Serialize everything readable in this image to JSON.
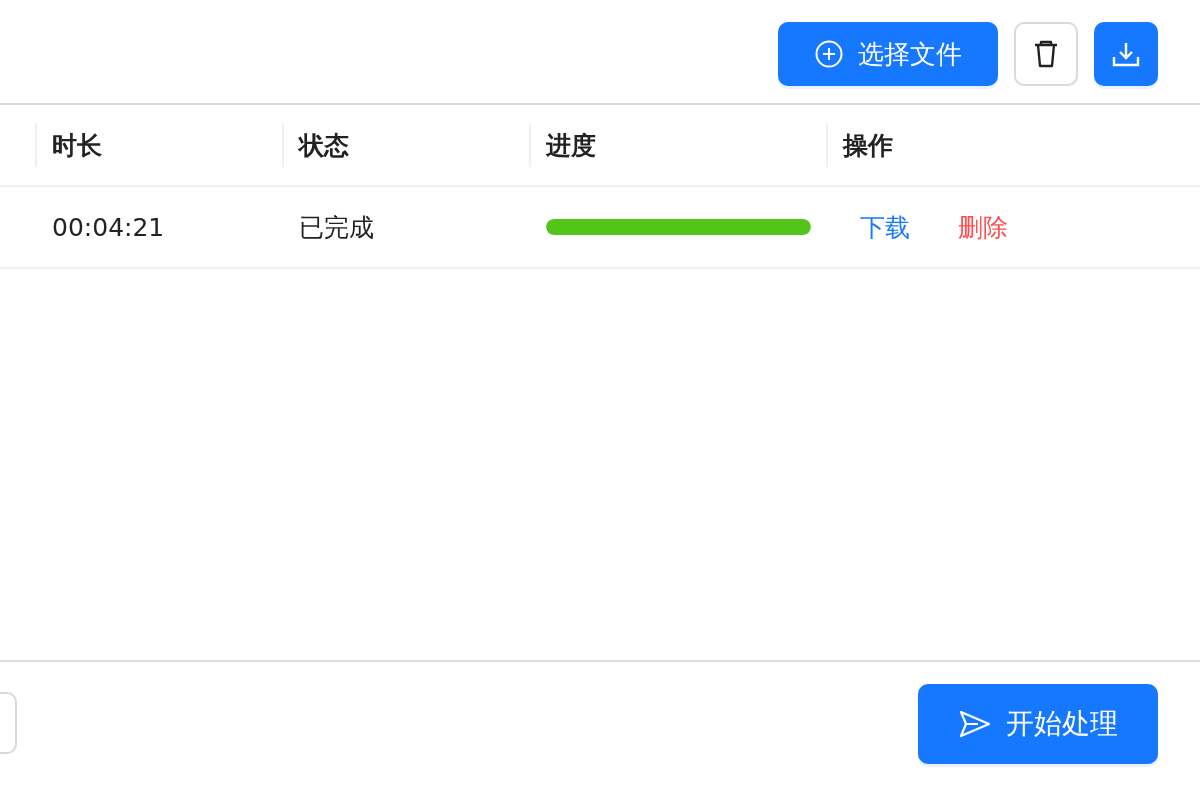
{
  "toolbar": {
    "select_button": "选择文件"
  },
  "table": {
    "columns": [
      "时长",
      "状态",
      "进度",
      "操作"
    ],
    "rows": [
      {
        "duration": "00:04:21",
        "status": "已完成",
        "level": 1,
        "actions": [
          "下载",
          "删除"
        ]
      }
    ]
  },
  "footer": {
    "start_button": "开始处理"
  }
}
